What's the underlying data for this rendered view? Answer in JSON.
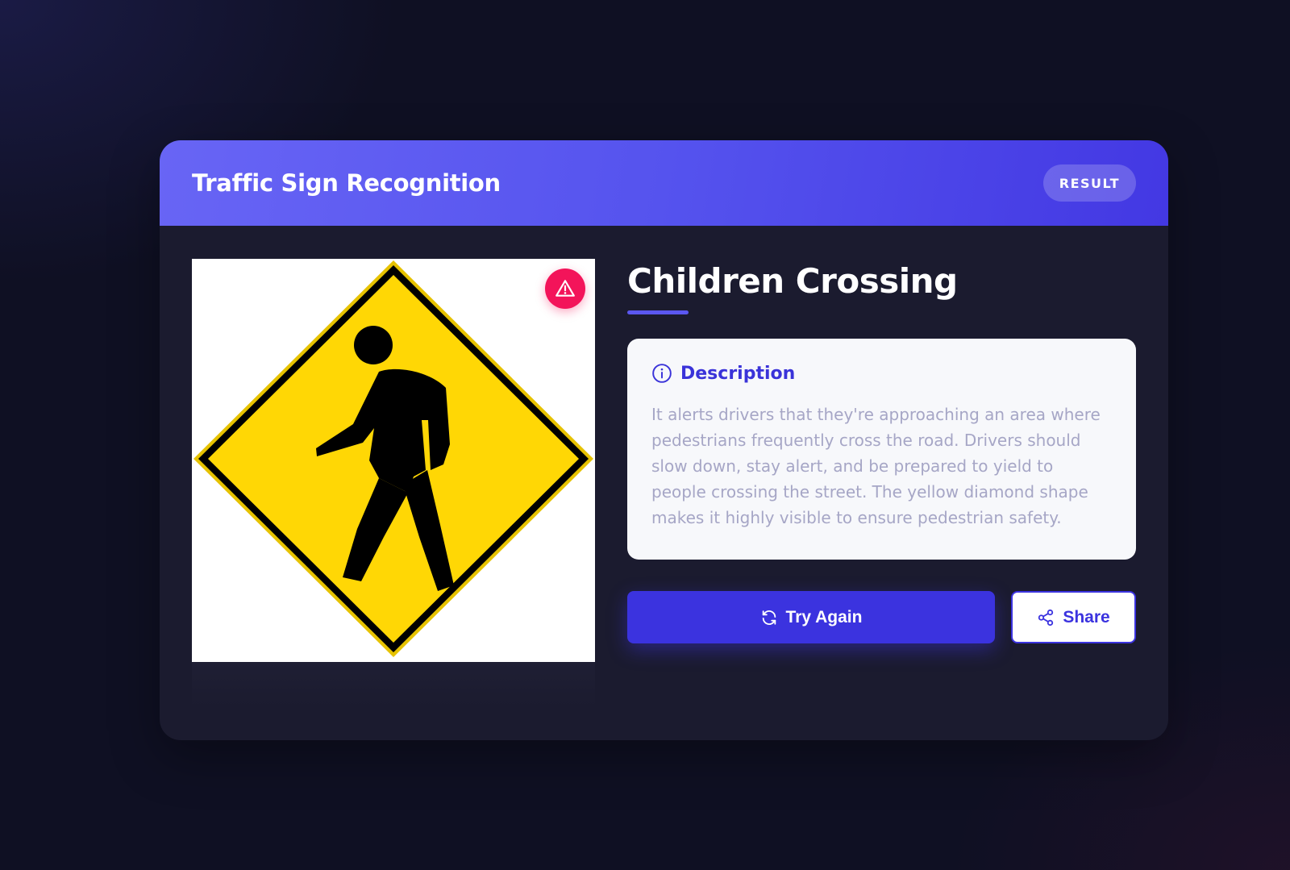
{
  "header": {
    "title": "Traffic Sign Recognition",
    "badge": "RESULT"
  },
  "image": {
    "alt": "Pedestrian crossing sign",
    "badge_icon": "warning-triangle-icon",
    "badge_color": "#f3145a"
  },
  "result": {
    "title": "Children Crossing"
  },
  "description": {
    "heading": "Description",
    "icon": "info-icon",
    "text": "It alerts drivers that they're approaching an area where pedestrians frequently cross the road. Drivers should slow down, stay alert, and be prepared to yield to people crossing the street. The yellow diamond shape makes it highly visible to ensure pedestrian safety."
  },
  "actions": {
    "try_again_label": "Try Again",
    "try_again_icon": "refresh-icon",
    "share_label": "Share",
    "share_icon": "share-icon"
  },
  "colors": {
    "accent": "#3b33df",
    "header_gradient_start": "#6865f5",
    "header_gradient_end": "#4338e3",
    "sign_yellow": "#ffd705",
    "warning_red": "#f3145a"
  }
}
